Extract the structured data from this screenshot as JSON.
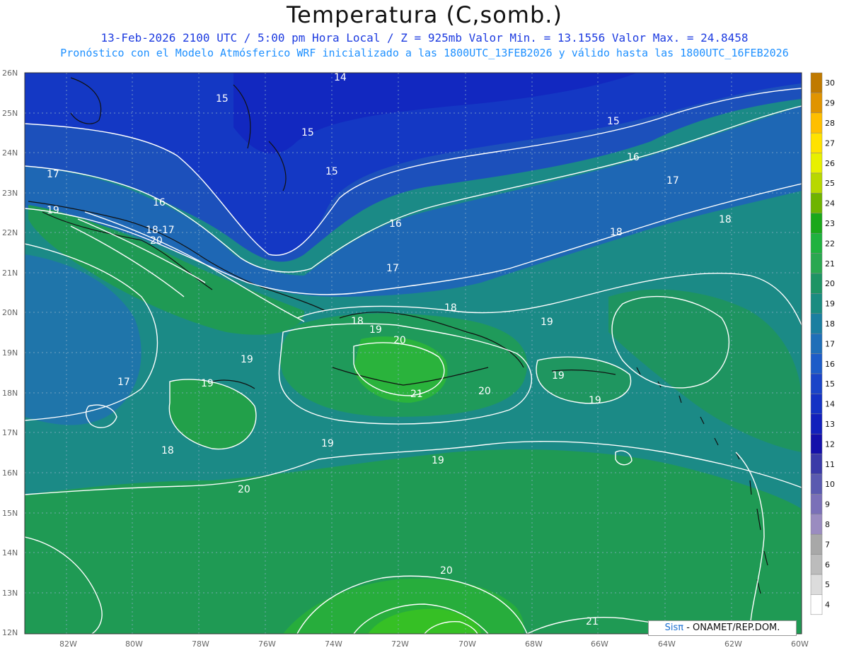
{
  "header": {
    "title": "Temperatura (C,somb.)",
    "line1": "13-Feb-2026  2100 UTC / 5:00 pm Hora Local / Z = 925mb    Valor Min. = 13.1556  Valor Max. = 24.8458",
    "line2": "Pronóstico con el Modelo Atmósferico WRF inicializado a las 1800UTC_13FEB2026 y válido hasta las  1800UTC_16FEB2026"
  },
  "map": {
    "lon_range": [
      -83.2,
      -60
    ],
    "lat_range": [
      12,
      26
    ],
    "lon_ticks": [
      "82W",
      "80W",
      "78W",
      "76W",
      "74W",
      "72W",
      "70W",
      "68W",
      "66W",
      "64W",
      "62W",
      "60W"
    ],
    "lat_ticks": [
      "26N",
      "25N",
      "24N",
      "23N",
      "22N",
      "21N",
      "20N",
      "19N",
      "18N",
      "17N",
      "16N",
      "15N",
      "14N",
      "13N",
      "12N"
    ],
    "contour_labels": [
      "14",
      "15",
      "15",
      "15",
      "15",
      "16",
      "16",
      "16",
      "17",
      "17",
      "17",
      "17",
      "18-17",
      "18",
      "18",
      "18",
      "18",
      "18",
      "19",
      "19",
      "19",
      "19",
      "19",
      "19",
      "19",
      "19",
      "19",
      "20",
      "20",
      "20",
      "20",
      "20",
      "21",
      "21"
    ],
    "colors": {
      "cold": "#1437c8",
      "cool": "#1f6fb4",
      "mild": "#1c8a82",
      "warm": "#1f9a4e",
      "hot": "#2db82e"
    }
  },
  "colorbar": {
    "values": [
      "30",
      "29",
      "28",
      "27",
      "26",
      "25",
      "24",
      "23",
      "22",
      "21",
      "20",
      "19",
      "18",
      "17",
      "16",
      "15",
      "14",
      "13",
      "12",
      "11",
      "10",
      "9",
      "8",
      "7",
      "6",
      "5",
      "4"
    ],
    "colors": [
      "#c07a00",
      "#e09400",
      "#ffbf00",
      "#ffe200",
      "#e8f000",
      "#b8d800",
      "#6fb400",
      "#1aa81a",
      "#1fb23f",
      "#2aa850",
      "#1e9464",
      "#1a8c80",
      "#1b7fa0",
      "#1f6fb8",
      "#1d5cc8",
      "#1a44c8",
      "#1432c4",
      "#1220bc",
      "#1410aa",
      "#3a3aa8",
      "#5a5ab0",
      "#7a70b8",
      "#9a8cc0",
      "#a8a8a8",
      "#bcbcbc",
      "#dcdcdc",
      "#ffffff"
    ]
  },
  "credit": {
    "logo": "Sisπ",
    "text": "- ONAMET/REP.DOM."
  }
}
